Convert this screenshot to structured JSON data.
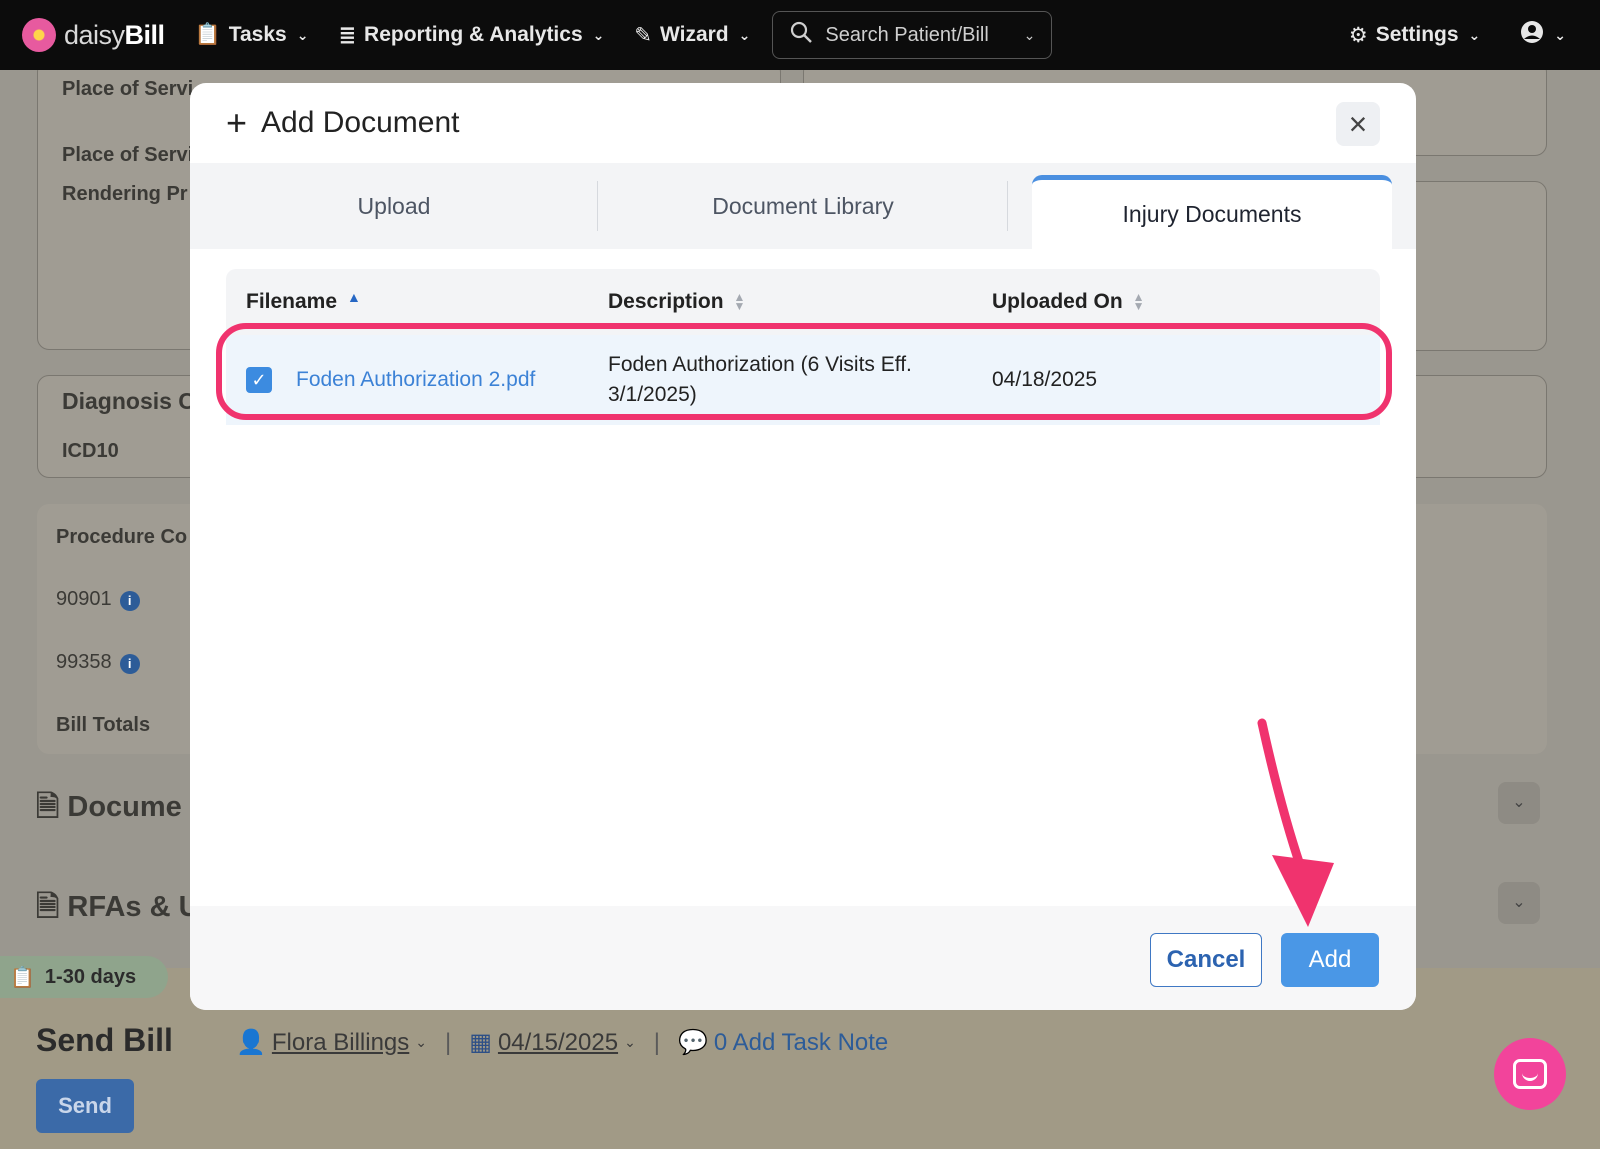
{
  "nav": {
    "brand_light": "daisy",
    "brand_bold": "Bill",
    "tasks": "Tasks",
    "reporting": "Reporting & Analytics",
    "wizard": "Wizard",
    "search_placeholder": "Search Patient/Bill",
    "settings": "Settings"
  },
  "background": {
    "place_of_service_1": "Place of Servi",
    "place_of_service_2": "Place of Servi",
    "rendering": "Rendering Pr",
    "diagnosis": "Diagnosis C",
    "icd10": "ICD10",
    "procedure": "Procedure Co",
    "code_1": "90901",
    "code_2": "99358",
    "bill_totals": "Bill Totals",
    "documents": "Docume",
    "rfas": "RFAs & U",
    "days_pill": "1-30 days",
    "send_bill_title": "Send Bill",
    "assignee": "Flora Billings",
    "date": "04/15/2025",
    "task_note": "0 Add Task Note",
    "send_button": "Send"
  },
  "modal": {
    "title": "Add Document",
    "tabs": [
      {
        "label": "Upload",
        "active": false
      },
      {
        "label": "Document Library",
        "active": false
      },
      {
        "label": "Injury Documents",
        "active": true
      }
    ],
    "table": {
      "columns": [
        "Filename",
        "Description",
        "Uploaded On"
      ],
      "rows": [
        {
          "checked": true,
          "filename": "Foden Authorization 2.pdf",
          "description_line1": "Foden Authorization (6 Visits Eff.",
          "description_line2": "3/1/2025)",
          "uploaded_on": "04/18/2025"
        }
      ]
    },
    "cancel_label": "Cancel",
    "add_label": "Add"
  },
  "colors": {
    "accent": "#4a97e6",
    "highlight": "#f0336e",
    "nav_bg": "#0c0c0c"
  }
}
